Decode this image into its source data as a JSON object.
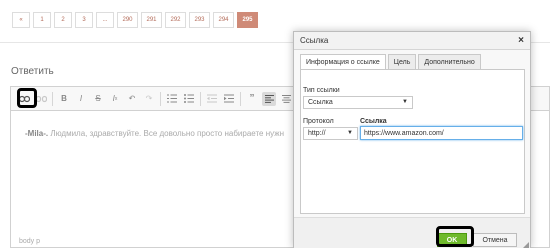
{
  "pagination": {
    "prev": "«",
    "pages": [
      "1",
      "2",
      "3",
      "...",
      "290",
      "291",
      "292",
      "293",
      "294",
      "295"
    ],
    "active": "295"
  },
  "reply_title": "Ответить",
  "editor": {
    "content_author": "-Mila-.",
    "content_text": " Людмила, здравствуйте. Все довольно просто набираете нужн",
    "status_path": "body  p"
  },
  "link_dialog": {
    "title": "Ссылка",
    "close": "×",
    "tabs": [
      "Информация о ссылке",
      "Цель",
      "Дополнительно"
    ],
    "link_type_label": "Тип ссылки",
    "link_type_value": "Ссылка",
    "protocol_label": "Протокол",
    "protocol_value": "http://",
    "url_label": "Ссылка",
    "url_value": "https://www.amazon.com/",
    "ok_label": "OK",
    "cancel_label": "Отмена"
  },
  "toolbar_icons": [
    "link-icon",
    "unlink-icon",
    "bold-icon",
    "italic-icon",
    "strikethrough-icon",
    "remove-format-icon",
    "undo-icon",
    "redo-icon",
    "numbered-list-icon",
    "bulleted-list-icon",
    "outdent-icon",
    "indent-icon",
    "blockquote-icon",
    "align-left-icon",
    "align-center-icon"
  ],
  "colors": {
    "accent": "#cf8a77",
    "ok_button": "#6fba2c",
    "focus": "#66afe9"
  }
}
